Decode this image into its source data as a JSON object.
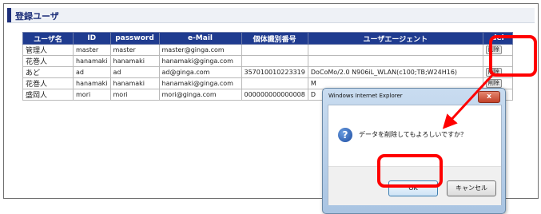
{
  "section": {
    "title": "登録ユーザ"
  },
  "table": {
    "headers": [
      "ユーザ名",
      "ID",
      "password",
      "e-Mail",
      "個体識別番号",
      "ユーザエージェント",
      "del"
    ],
    "rows": [
      {
        "name": "管理人",
        "id": "master",
        "password": "master",
        "email": "master@ginga.com",
        "device_id": "",
        "user_agent": "",
        "action": "削除"
      },
      {
        "name": "花巻人",
        "id": "hanamaki",
        "password": "hanamaki",
        "email": "hanamaki@ginga.com",
        "device_id": "",
        "user_agent": "",
        "action": ""
      },
      {
        "name": "あど",
        "id": "ad",
        "password": "ad",
        "email": "ad@ginga.com",
        "device_id": "357010010223319",
        "user_agent": "DoCoMo/2.0 N906iL_WLAN(c100;TB;W24H16)",
        "action": "削除"
      },
      {
        "name": "花巻人",
        "id": "hanamaki",
        "password": "hanamaki",
        "email": "hanamaki@ginga.com",
        "device_id": "",
        "user_agent": "M",
        "action": "削除"
      },
      {
        "name": "盛岡人",
        "id": "mori",
        "password": "mori",
        "email": "mori@ginga.com",
        "device_id": "000000000000008",
        "user_agent": "D",
        "action": "削除"
      }
    ]
  },
  "dialog": {
    "title": "Windows Internet Explorer",
    "close_label": "x",
    "icon": "question-icon",
    "message": "データを削除してもよろしいですか？",
    "ok_label": "OK",
    "cancel_label": "キャンセル"
  },
  "annotation_color": "#ff0000"
}
